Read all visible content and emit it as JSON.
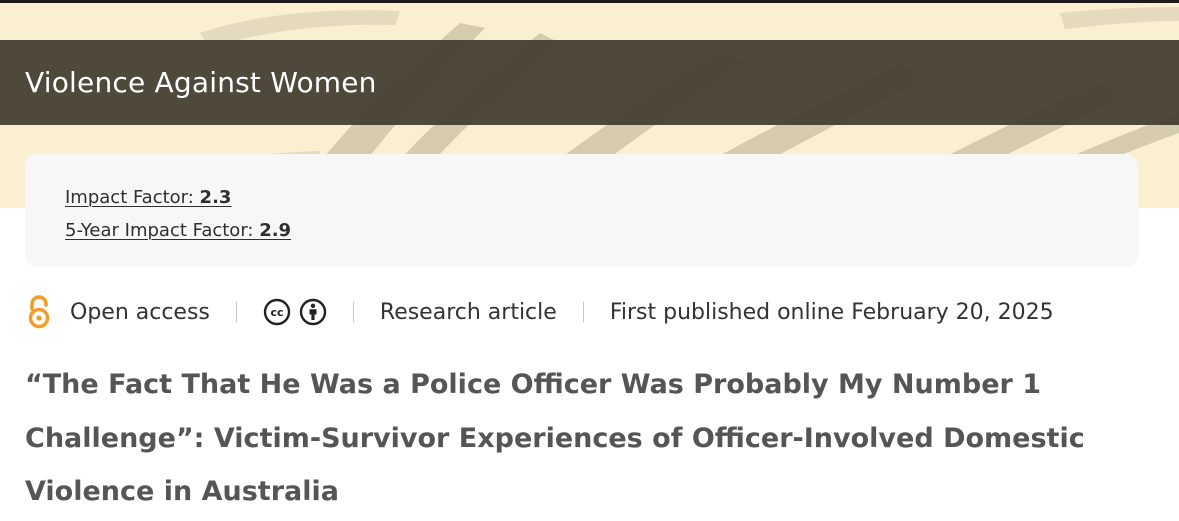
{
  "journal": {
    "title": "Violence Against Women"
  },
  "metrics": {
    "impact_factor_label": "Impact Factor: ",
    "impact_factor_value": "2.3",
    "five_year_label": "5-Year Impact Factor: ",
    "five_year_value": "2.9"
  },
  "meta": {
    "access": "Open access",
    "license_icons": [
      "cc-icon",
      "attribution-icon"
    ],
    "article_type": "Research article",
    "published": "First published online February 20, 2025"
  },
  "article": {
    "title": "“The Fact That He Was a Police Officer Was Probably My Number 1 Challenge”: Victim-Survivor Experiences of Officer-Involved Domestic Violence in Australia"
  },
  "colors": {
    "banner_bg": "#fbefd2",
    "title_bar": "#423c30",
    "open_access_orange": "#f39c26",
    "title_text": "#555555"
  }
}
